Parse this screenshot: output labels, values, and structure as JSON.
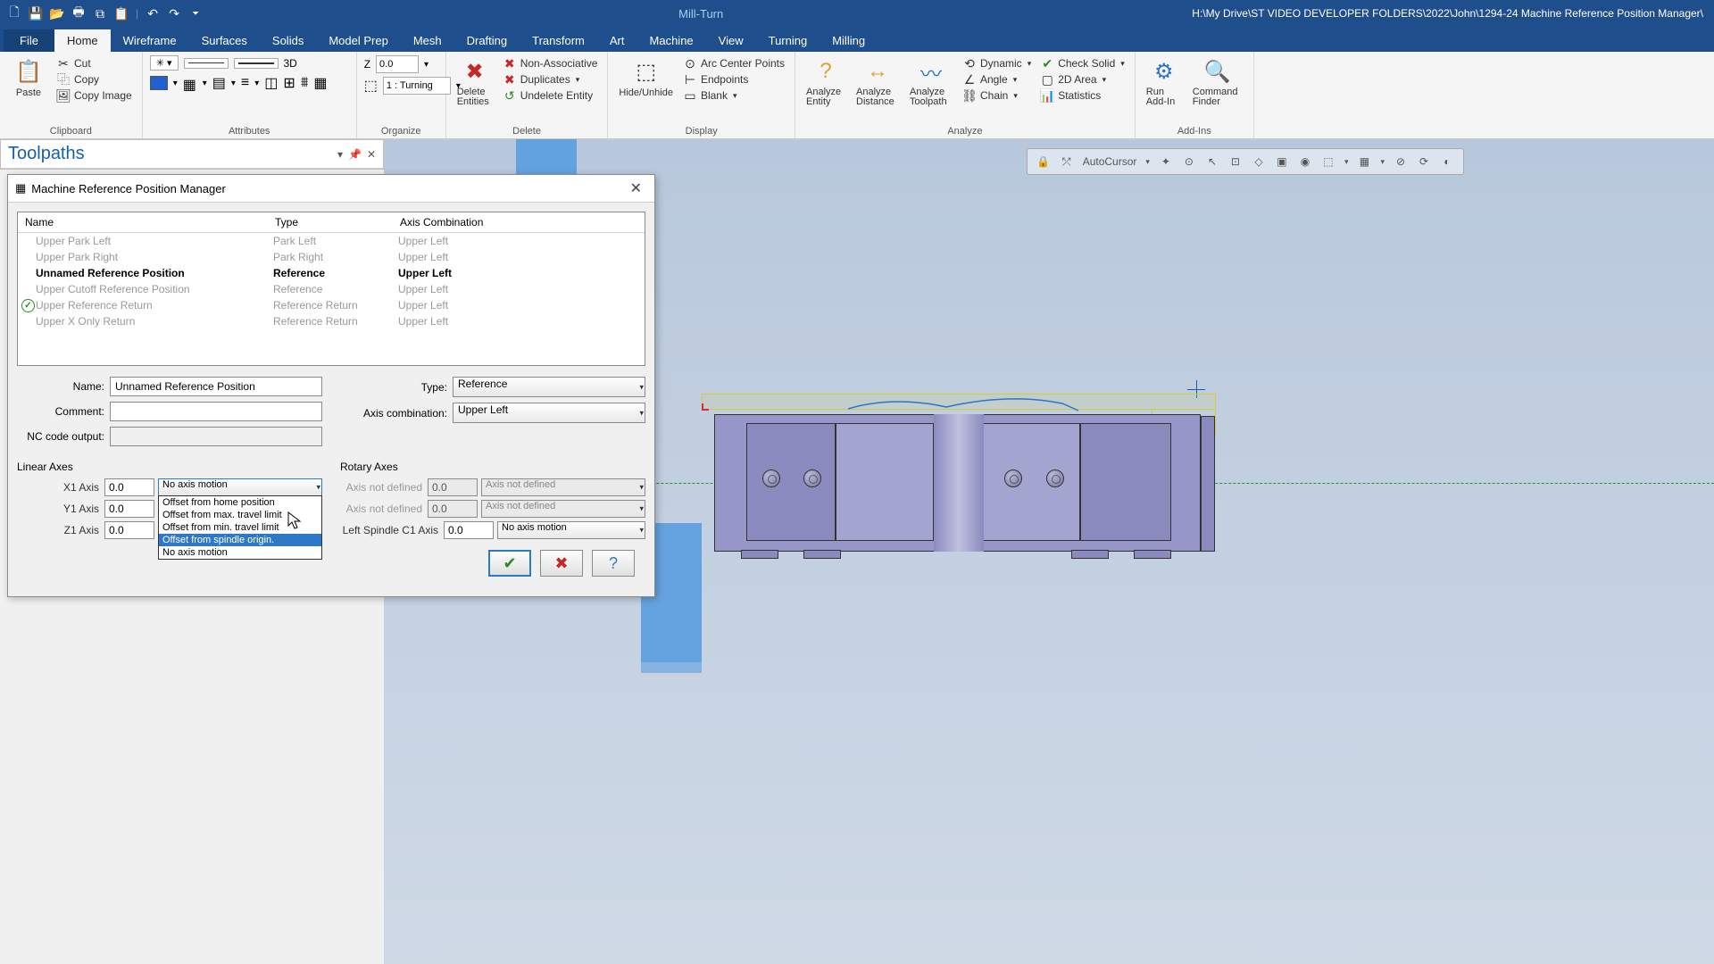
{
  "titlebar": {
    "context_tab": "Mill-Turn",
    "path": "H:\\My Drive\\ST VIDEO DEVELOPER FOLDERS\\2022\\John\\1294-24 Machine Reference Position Manager\\"
  },
  "tabs": {
    "file": "File",
    "home": "Home",
    "wireframe": "Wireframe",
    "surfaces": "Surfaces",
    "solids": "Solids",
    "modelprep": "Model Prep",
    "mesh": "Mesh",
    "drafting": "Drafting",
    "transform": "Transform",
    "art": "Art",
    "machine": "Machine",
    "view": "View",
    "turning": "Turning",
    "milling": "Milling"
  },
  "ribbon": {
    "clipboard": {
      "label": "Clipboard",
      "paste": "Paste",
      "cut": "Cut",
      "copy": "Copy",
      "copyimage": "Copy Image"
    },
    "attributes": {
      "label": "Attributes",
      "threeD": "3D",
      "z_label": "Z",
      "z_val": "0.0",
      "plane_val": "1 : Turning"
    },
    "organize": {
      "label": "Organize"
    },
    "delete": {
      "label": "Delete",
      "delete_entities": "Delete Entities",
      "nonassoc": "Non-Associative",
      "duplicates": "Duplicates",
      "undelete": "Undelete Entity"
    },
    "display": {
      "label": "Display",
      "hide": "Hide/Unhide",
      "arccenter": "Arc Center Points",
      "endpoints": "Endpoints",
      "blank": "Blank"
    },
    "analyze": {
      "label": "Analyze",
      "entity": "Analyze Entity",
      "distance": "Analyze Distance",
      "toolpath": "Analyze Toolpath",
      "dynamic": "Dynamic",
      "angle": "Angle",
      "chain": "Chain",
      "checksolid": "Check Solid",
      "area": "2D Area",
      "statistics": "Statistics"
    },
    "addins": {
      "label": "Add-Ins",
      "run": "Run Add-In",
      "finder": "Command Finder"
    }
  },
  "toolpaths": {
    "title": "Toolpaths"
  },
  "dialog": {
    "title": "Machine Reference Position Manager",
    "columns": {
      "name": "Name",
      "type": "Type",
      "axis": "Axis Combination"
    },
    "rows": [
      {
        "name": "Upper Park Left",
        "type": "Park Left",
        "axis": "Upper Left",
        "selected": false,
        "checked": false
      },
      {
        "name": "Upper Park Right",
        "type": "Park Right",
        "axis": "Upper Left",
        "selected": false,
        "checked": false
      },
      {
        "name": "Unnamed Reference Position",
        "type": "Reference",
        "axis": "Upper Left",
        "selected": true,
        "checked": false
      },
      {
        "name": "Upper Cutoff Reference Position",
        "type": "Reference",
        "axis": "Upper Left",
        "selected": false,
        "checked": false
      },
      {
        "name": "Upper Reference Return",
        "type": "Reference Return",
        "axis": "Upper Left",
        "selected": false,
        "checked": true
      },
      {
        "name": "Upper X Only Return",
        "type": "Reference Return",
        "axis": "Upper Left",
        "selected": false,
        "checked": false
      }
    ],
    "form": {
      "name_label": "Name:",
      "name_val": "Unnamed Reference Position",
      "comment_label": "Comment:",
      "comment_val": "",
      "nc_label": "NC code output:",
      "nc_val": "",
      "type_label": "Type:",
      "type_val": "Reference",
      "combo_label": "Axis combination:",
      "combo_val": "Upper Left"
    },
    "linear": {
      "title": "Linear Axes",
      "x1_label": "X1 Axis",
      "x1_val": "0.0",
      "x1_sel": "No axis motion",
      "y1_label": "Y1 Axis",
      "y1_val": "0.0",
      "z1_label": "Z1 Axis",
      "z1_val": "0.0",
      "dropdown_options": [
        "Offset from home position",
        "Offset from max. travel limit",
        "Offset from min. travel limit",
        "Offset from spindle origin.",
        "No axis motion"
      ]
    },
    "rotary": {
      "title": "Rotary Axes",
      "und_label": "Axis not defined",
      "und_val": "0.0",
      "und_sel": "Axis not defined",
      "c1_label": "Left Spindle C1 Axis",
      "c1_val": "0.0",
      "c1_sel": "No axis motion"
    }
  },
  "selectionbar": {
    "autocursor": "AutoCursor"
  }
}
